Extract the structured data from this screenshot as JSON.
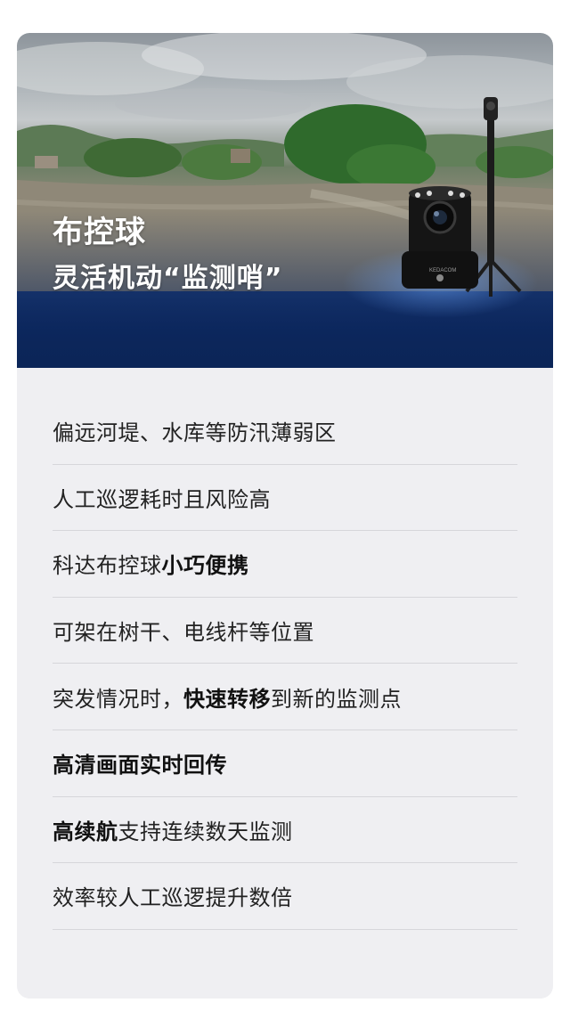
{
  "hero": {
    "title": "布控球",
    "subtitle": "灵活机动“监测哨”",
    "camera_label": "KEDACOM"
  },
  "features": [
    {
      "segments": [
        {
          "text": "偏远河堤、水库等防汛薄弱区",
          "bold": false
        }
      ]
    },
    {
      "segments": [
        {
          "text": "人工巡逻耗时且风险高",
          "bold": false
        }
      ]
    },
    {
      "segments": [
        {
          "text": "科达布控球",
          "bold": false
        },
        {
          "text": "小巧便携",
          "bold": true
        }
      ]
    },
    {
      "segments": [
        {
          "text": "可架在树干、电线杆等位置",
          "bold": false
        }
      ]
    },
    {
      "segments": [
        {
          "text": "突发情况时，",
          "bold": false
        },
        {
          "text": "快速转移",
          "bold": true
        },
        {
          "text": "到新的监测点",
          "bold": false
        }
      ]
    },
    {
      "segments": [
        {
          "text": "高清画面实时回传",
          "bold": true
        }
      ]
    },
    {
      "segments": [
        {
          "text": "高续航",
          "bold": true
        },
        {
          "text": "支持连续数天监测",
          "bold": false
        }
      ]
    },
    {
      "segments": [
        {
          "text": "效率较人工巡逻提升数倍",
          "bold": false
        }
      ]
    }
  ],
  "colors": {
    "card_background": "#efeff2",
    "hero_blue": "#0b2558",
    "divider": "#d6d6da",
    "text": "#222222"
  }
}
